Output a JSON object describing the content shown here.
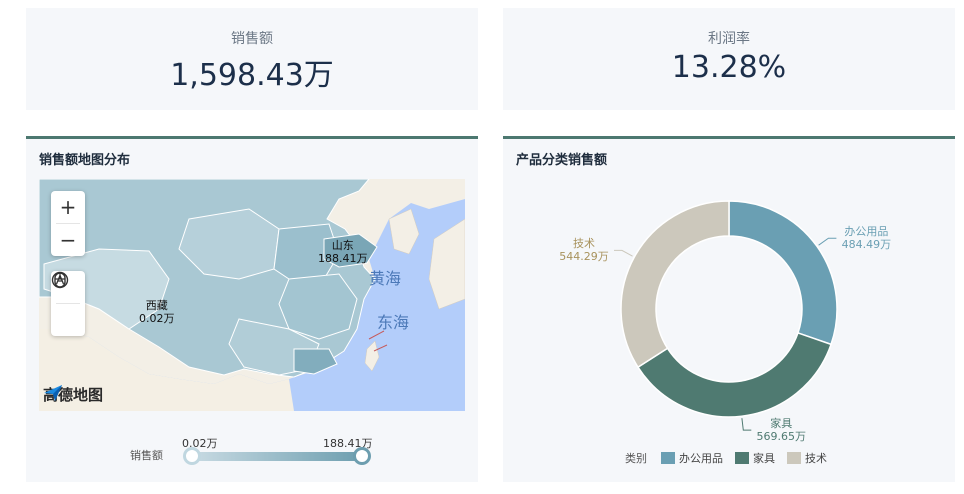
{
  "kpi": {
    "sales_label": "销售额",
    "sales_value": "1,598.43万",
    "profit_label": "利润率",
    "profit_value": "13.28%"
  },
  "map_panel": {
    "title": "销售额地图分布",
    "zoom_in": "+",
    "zoom_out": "−",
    "logo_text": "高德地图",
    "regions": [
      {
        "name": "山东",
        "value": "188.41万"
      },
      {
        "name": "西藏",
        "value": "0.02万"
      }
    ],
    "seas": [
      "黄海",
      "东海"
    ],
    "legend": {
      "name": "销售额",
      "min": "0.02万",
      "max": "188.41万"
    },
    "colors": {
      "water": "#b3cdfa",
      "land_low": "#c9dbe3",
      "land_high": "#6d9eaf"
    }
  },
  "donut_panel": {
    "title": "产品分类销售额",
    "legend_title": "类别"
  },
  "chart_data": {
    "type": "pie",
    "title": "产品分类销售额",
    "categories": [
      "办公用品",
      "家具",
      "技术"
    ],
    "values": [
      484.49,
      569.65,
      544.29
    ],
    "labels": [
      "484.49万",
      "569.65万",
      "544.29万"
    ],
    "colors": [
      "#6a9fb3",
      "#4f7a71",
      "#ccc8bc"
    ],
    "legend_position": "bottom"
  }
}
